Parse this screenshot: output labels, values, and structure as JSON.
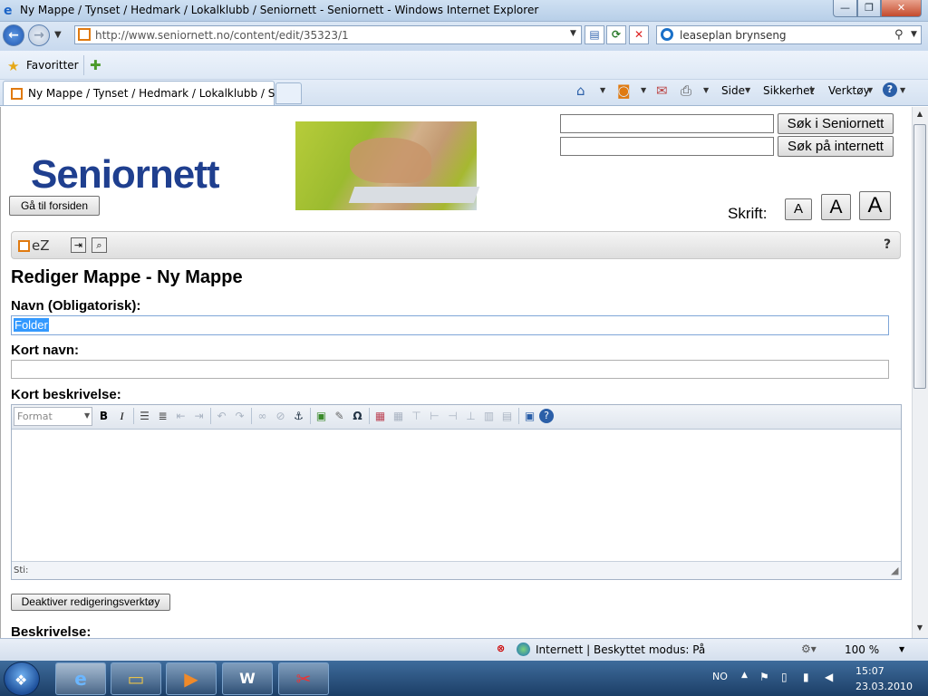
{
  "window": {
    "title": "Ny Mappe / Tynset / Hedmark / Lokalklubb / Seniornett - Seniornett - Windows Internet Explorer",
    "min": "—",
    "max": "❐",
    "close": "✕"
  },
  "address": {
    "url": "http://www.seniornett.no/content/edit/35323/1",
    "search_query": "leaseplan brynseng"
  },
  "favorites": {
    "label": "Favoritter"
  },
  "tabs": [
    {
      "label": "Ny Mappe / Tynset / Hedmark / Lokalklubb / Sen..."
    }
  ],
  "commandbar": {
    "side": "Side",
    "sikkerhet": "Sikkerhet",
    "verktoy": "Verktøy"
  },
  "site": {
    "logo_text": "Seniornett",
    "home_button": "Gå til forsiden",
    "search_site_button": "Søk i Seniornett",
    "search_web_button": "Søk på internett",
    "font_label": "Skrift:",
    "font_small": "A",
    "font_medium": "A",
    "font_large": "A"
  },
  "ez": {
    "logo": "eZ",
    "help": "?"
  },
  "form": {
    "title": "Rediger Mappe - Ny Mappe",
    "name_label": "Navn (Obligatorisk):",
    "name_value": "Folder",
    "short_name_label": "Kort navn:",
    "short_name_value": "",
    "short_desc_label": "Kort beskrivelse:",
    "format_select": "Format",
    "path_label": "Sti:",
    "toggle_editor_button": "Deaktiver redigeringsverktøy",
    "long_desc_label": "Beskrivelse:"
  },
  "status": {
    "zone": "Internett | Beskyttet modus: På",
    "zoom": "100 %"
  },
  "taskbar": {
    "language": "NO",
    "time": "15:07",
    "date": "23.03.2010"
  },
  "icons": {
    "back": "back-arrow-icon",
    "forward": "forward-arrow-icon",
    "refresh": "refresh-icon",
    "stop": "stop-icon",
    "home": "home-icon",
    "feeds": "rss-icon",
    "print": "printer-icon"
  }
}
